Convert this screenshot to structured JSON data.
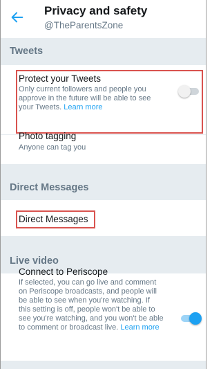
{
  "header": {
    "title": "Privacy and safety",
    "handle": "@TheParentsZone"
  },
  "sections": {
    "tweets": {
      "header": "Tweets",
      "protect": {
        "title": "Protect your Tweets",
        "desc_line1": "Only current followers and people you",
        "desc_line2": "approve in the future will be able to see",
        "desc_line3_prefix": "your Tweets. ",
        "learn_more": "Learn more",
        "enabled": false
      },
      "photo_tagging": {
        "title": "Photo tagging",
        "desc": "Anyone can tag you"
      }
    },
    "direct_messages": {
      "header": "Direct Messages",
      "item": "Direct Messages"
    },
    "live_video": {
      "header": "Live video",
      "periscope": {
        "title": "Connect to Periscope",
        "desc_line1": "If selected, you can go live and comment",
        "desc_line2": "on Periscope broadcasts, and people will",
        "desc_line3": "be able to see when you're watching. If",
        "desc_line4": "this setting is off, people won't be able to",
        "desc_line5": "see you're watching, and you won't be able",
        "desc_line6_prefix": "to comment or broadcast live. ",
        "learn_more": "Learn more",
        "enabled": true
      }
    }
  },
  "colors": {
    "accent": "#1da1f2",
    "highlight": "#d9534f",
    "section_bg": "#e6ecf0"
  }
}
